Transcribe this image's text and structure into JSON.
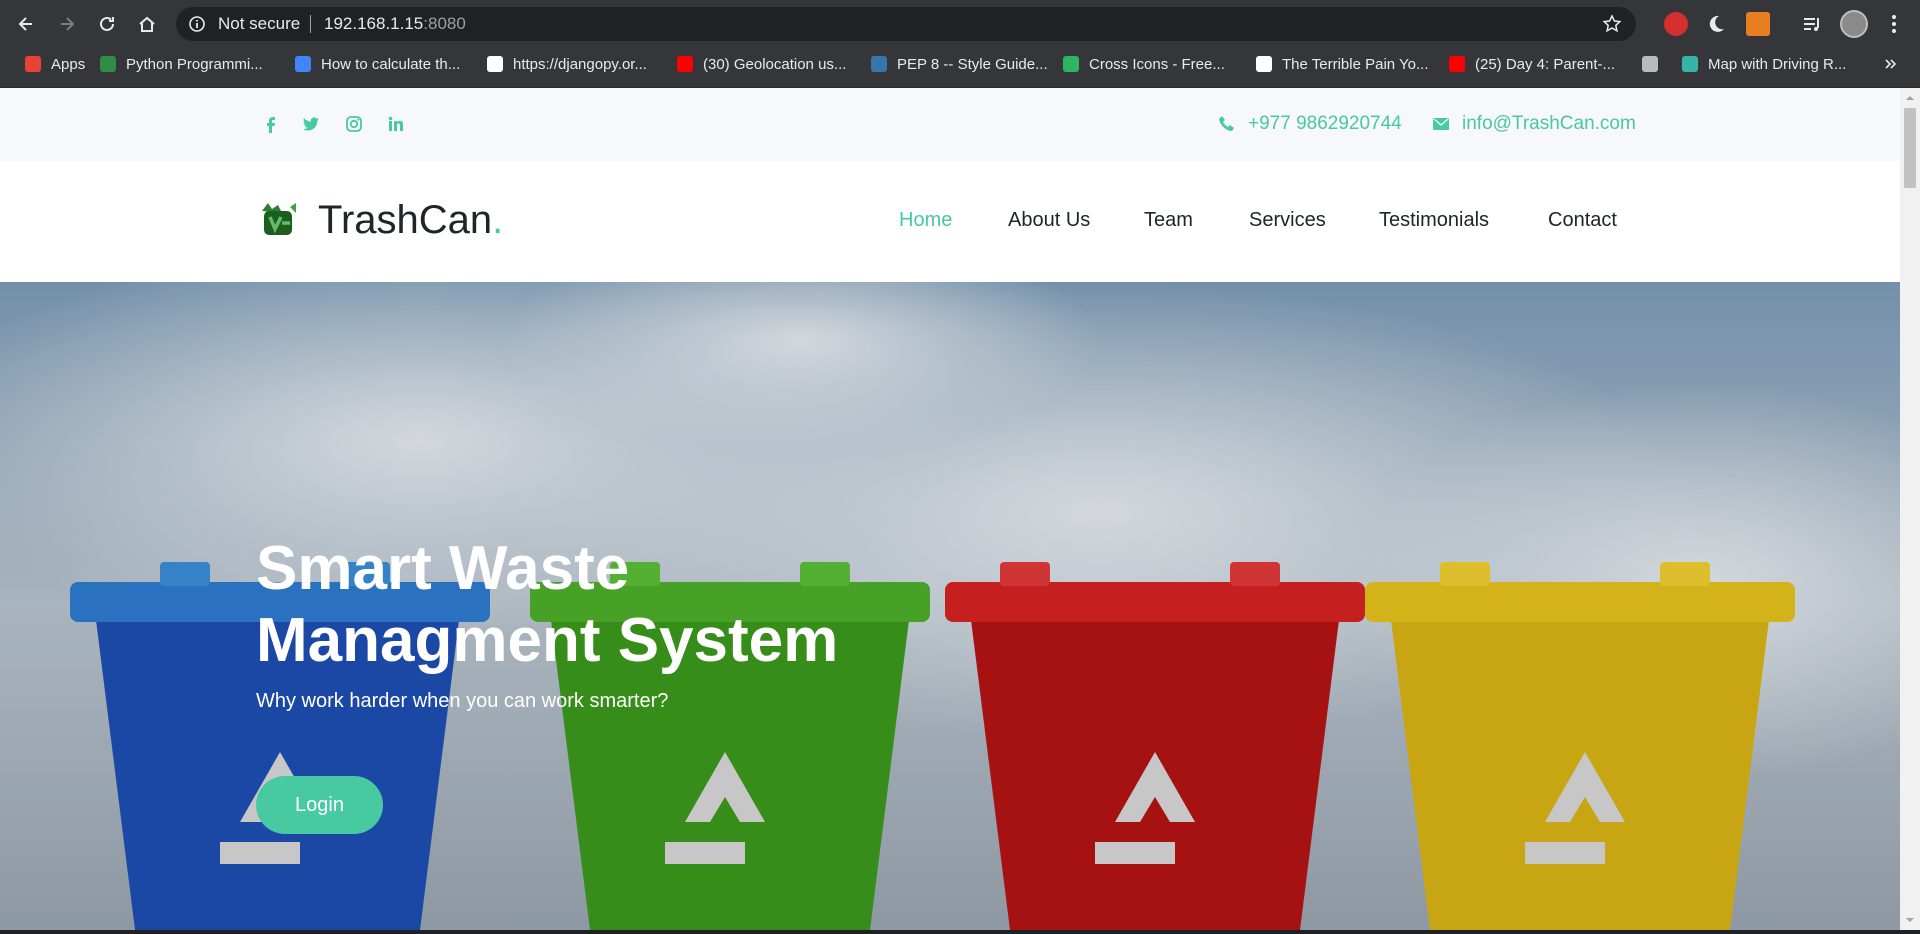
{
  "browser": {
    "security_label": "Not secure",
    "url_host": "192.168.1.15",
    "url_port": ":8080",
    "bookmarks": [
      {
        "label": "Apps",
        "icon": "apps-grid-icon",
        "color": "#e94235"
      },
      {
        "label": "Python Programmi...",
        "icon": "geeksforgeeks-icon",
        "color": "#2f8d46"
      },
      {
        "label": "How to calculate th...",
        "icon": "eye-icon",
        "color": "#4285f4"
      },
      {
        "label": "https://djangopy.or...",
        "icon": "djangopy-icon",
        "color": "#ffffff"
      },
      {
        "label": "(30) Geolocation us...",
        "icon": "youtube-icon",
        "color": "#ff0000"
      },
      {
        "label": "PEP 8 -- Style Guide...",
        "icon": "python-icon",
        "color": "#3776ab"
      },
      {
        "label": "Cross Icons - Free...",
        "icon": "flaticon-icon",
        "color": "#2db563"
      },
      {
        "label": "The Terrible Pain Yo...",
        "icon": "medium-icon",
        "color": "#ffffff"
      },
      {
        "label": "(25) Day 4: Parent-...",
        "icon": "youtube-icon",
        "color": "#ff0000"
      },
      {
        "label": "",
        "icon": "guitar-icon",
        "color": "#bbbbbb"
      },
      {
        "label": "Map with Driving R...",
        "icon": "map-icon",
        "color": "#36b4a8"
      }
    ]
  },
  "topbar": {
    "phone": "+977 9862920744",
    "email": "info@TrashCan.com",
    "social": [
      "facebook-icon",
      "twitter-icon",
      "instagram-icon",
      "linkedin-icon"
    ]
  },
  "brand": {
    "name": "TrashCan",
    "dot": "."
  },
  "nav": {
    "items": [
      "Home",
      "About Us",
      "Team",
      "Services",
      "Testimonials",
      "Contact"
    ],
    "active": "Home"
  },
  "hero": {
    "title": "Smart Waste Managment System",
    "subtitle": "Why work harder when you can work smarter?",
    "button": "Login"
  },
  "colors": {
    "accent": "#47c9a2",
    "text": "#212529",
    "chrome": "#35363a"
  }
}
